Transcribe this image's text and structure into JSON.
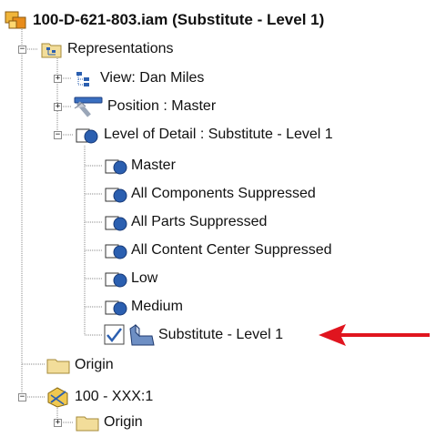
{
  "tree": {
    "root_label": "100-D-621-803.iam (Substitute - Level 1)",
    "representations_label": "Representations",
    "view_label": "View: Dan Miles",
    "position_label": "Position : Master",
    "lod_label": "Level of Detail : Substitute - Level 1",
    "lod_items": [
      "Master",
      "All Components Suppressed",
      "All Parts Suppressed",
      "All Content Center Suppressed",
      "Low",
      "Medium"
    ],
    "substitute_label": "Substitute - Level 1",
    "origin_label": "Origin",
    "component_label": "100 - XXX:1",
    "component_origin_label": "Origin"
  },
  "colors": {
    "arrow": "#e0151f",
    "folder": "#f2dd9a",
    "lod_blue": "#2b5fb0",
    "tree_lines": "#8a8a8a"
  },
  "icons": {
    "assembly": "assembly-icon",
    "representations": "representations-folder-icon",
    "view": "view-rep-icon",
    "position": "position-rep-icon",
    "lod": "level-of-detail-icon",
    "checkmark": "checkmark-icon",
    "substitute": "substitute-part-icon",
    "folder": "folder-icon",
    "component": "component-icon"
  }
}
